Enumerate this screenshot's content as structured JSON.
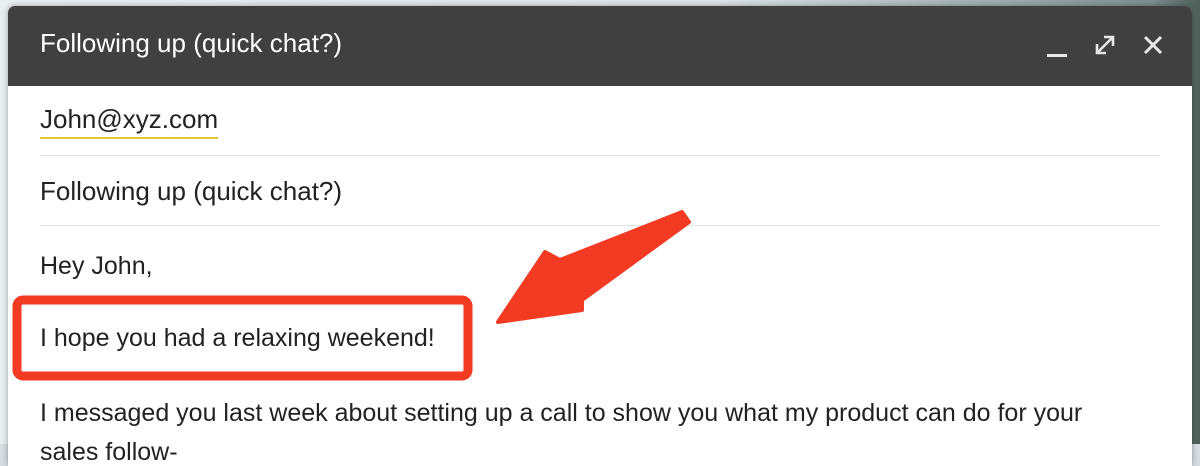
{
  "window": {
    "title": "Following up (quick chat?)",
    "controls": [
      "minimize-icon",
      "expand-icon",
      "close-icon"
    ]
  },
  "fields": {
    "to": "John@xyz.com",
    "subject": "Following up (quick chat?)"
  },
  "body": {
    "greeting": "Hey John,",
    "highlighted_line": "I hope you had a relaxing weekend!",
    "paragraph": "I messaged you last week about setting up a call to show you what my product can do for your",
    "paragraph_cont": "sales follow-"
  },
  "annotation": {
    "highlight_color": "#f33a22",
    "arrow_color": "#f33a22"
  },
  "colors": {
    "titlebar": "#404040",
    "to_underline": "#e6c52f"
  }
}
